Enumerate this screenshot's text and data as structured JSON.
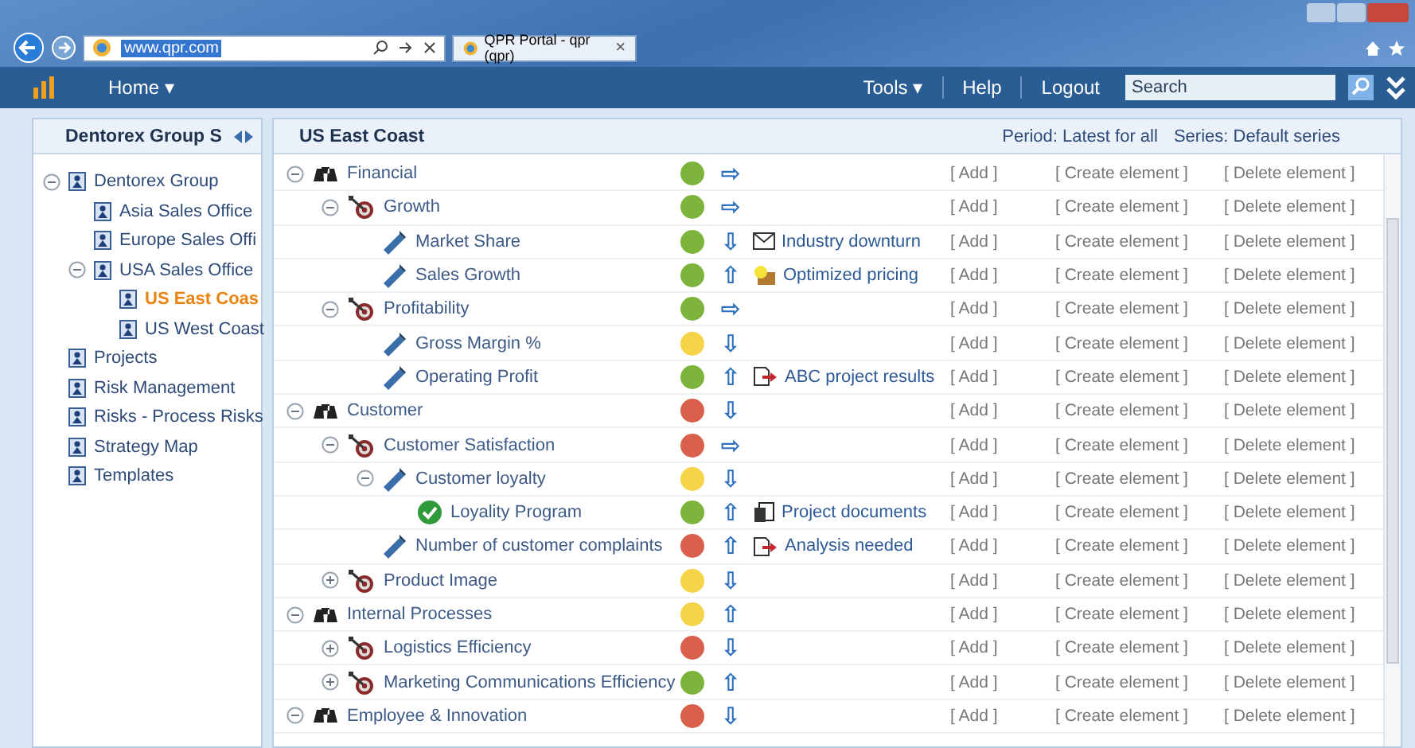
{
  "browser": {
    "address": "www.qpr.com",
    "tab": {
      "label": "QPR Portal - qpr (qpr)",
      "close": "×"
    }
  },
  "app_bar": {
    "home": "Home ▾",
    "menu": [
      {
        "label": "Tools ▾"
      },
      {
        "label": "Help"
      },
      {
        "label": "Logout"
      }
    ],
    "search": {
      "placeholder": "Search"
    }
  },
  "sidebar": {
    "title": "Dentorex Group S",
    "items": [
      {
        "label": "Dentorex Group",
        "expanded": true,
        "selected": false,
        "children": [
          {
            "label": "Asia Sales Office",
            "selected": false
          },
          {
            "label": "Europe Sales Offi",
            "selected": false
          },
          {
            "label": "USA Sales Office",
            "expanded": true,
            "selected": false,
            "children": [
              {
                "label": "US East Coas",
                "selected": true
              },
              {
                "label": "US West Coast",
                "selected": false
              }
            ]
          }
        ]
      },
      {
        "label": "Projects",
        "selected": false
      },
      {
        "label": "Risk Management",
        "selected": false
      },
      {
        "label": "Risks - Process Risks",
        "selected": false
      },
      {
        "label": "Strategy Map",
        "selected": false
      },
      {
        "label": "Templates",
        "selected": false
      }
    ]
  },
  "scorecard": {
    "title": "US East Coast",
    "period": "Period: Latest for all",
    "series": "Series: Default series",
    "rows": [
      {
        "name": "Financial",
        "kind": "perspective",
        "expanded": true,
        "color": "#7cb43c",
        "trend": "⇨",
        "links": [
          "[ Add ]",
          "[ Create element ]",
          "[ Delete element ]"
        ],
        "children": [
          {
            "name": "Growth",
            "kind": "goal",
            "expanded": true,
            "color": "#7cb43c",
            "trend": "⇨",
            "links": [
              "[ Add ]",
              "[ Create element ]",
              "[ Delete element ]"
            ],
            "children": [
              {
                "name": "Market Share",
                "kind": "measure",
                "color": "#7cb43c",
                "trend": "⇩",
                "note": {
                  "kind": "mail",
                  "text": "Industry downturn"
                },
                "links": [
                  "[ Add ]",
                  "[ Create element ]",
                  "[ Delete element ]"
                ]
              },
              {
                "name": "Sales Growth",
                "kind": "measure",
                "color": "#7cb43c",
                "trend": "⇧",
                "note": {
                  "kind": "idea",
                  "text": "Optimized pricing"
                },
                "links": [
                  "[ Add ]",
                  "[ Create element ]",
                  "[ Delete element ]"
                ]
              }
            ]
          },
          {
            "name": "Profitability",
            "kind": "goal",
            "expanded": true,
            "color": "#7cb43c",
            "trend": "⇨",
            "links": [
              "[ Add ]",
              "[ Create element ]",
              "[ Delete element ]"
            ],
            "children": [
              {
                "name": "Gross Margin %",
                "kind": "measure",
                "color": "#f5d447",
                "trend": "⇩",
                "links": [
                  "[ Add ]",
                  "[ Create element ]",
                  "[ Delete element ]"
                ]
              },
              {
                "name": "Operating Profit",
                "kind": "measure",
                "color": "#7cb43c",
                "trend": "⇧",
                "note": {
                  "kind": "action",
                  "text": "ABC project results"
                },
                "links": [
                  "[ Add ]",
                  "[ Create element ]",
                  "[ Delete element ]"
                ]
              }
            ]
          }
        ]
      },
      {
        "name": "Customer",
        "kind": "perspective",
        "expanded": true,
        "color": "#d9614c",
        "trend": "⇩",
        "links": [
          "[ Add ]",
          "[ Create element ]",
          "[ Delete element ]"
        ],
        "children": [
          {
            "name": "Customer Satisfaction",
            "kind": "goal",
            "expanded": true,
            "color": "#d9614c",
            "trend": "⇨",
            "links": [
              "[ Add ]",
              "[ Create element ]",
              "[ Delete element ]"
            ],
            "children": [
              {
                "name": "Customer loyalty",
                "kind": "measure",
                "expanded": true,
                "color": "#f5d447",
                "trend": "⇩",
                "links": [
                  "[ Add ]",
                  "[ Create element ]",
                  "[ Delete element ]"
                ],
                "children": [
                  {
                    "name": "Loyality Program",
                    "kind": "check",
                    "color": "#7cb43c",
                    "trend": "⇧",
                    "note": {
                      "kind": "document",
                      "text": "Project documents"
                    },
                    "links": [
                      "[ Add ]",
                      "[ Create element ]",
                      "[ Delete element ]"
                    ]
                  }
                ]
              },
              {
                "name": "Number of customer complaints",
                "kind": "measure",
                "color": "#d9614c",
                "trend": "⇧",
                "note": {
                  "kind": "action",
                  "text": "Analysis needed"
                },
                "links": [
                  "[ Add ]",
                  "[ Create element ]",
                  "[ Delete element ]"
                ]
              }
            ]
          },
          {
            "name": "Product Image",
            "kind": "goal",
            "expanded": false,
            "color": "#f5d447",
            "trend": "⇩",
            "links": [
              "[ Add ]",
              "[ Create element ]",
              "[ Delete element ]"
            ]
          }
        ]
      },
      {
        "name": "Internal Processes",
        "kind": "perspective",
        "expanded": true,
        "color": "#f5d447",
        "trend": "⇧",
        "links": [
          "[ Add ]",
          "[ Create element ]",
          "[ Delete element ]"
        ],
        "children": [
          {
            "name": "Logistics Efficiency",
            "kind": "goal",
            "expanded": false,
            "color": "#d9614c",
            "trend": "⇩",
            "links": [
              "[ Add ]",
              "[ Create element ]",
              "[ Delete element ]"
            ]
          },
          {
            "name": "Marketing Communications Efficiency",
            "kind": "goal",
            "expanded": false,
            "color": "#7cb43c",
            "trend": "⇧",
            "links": [
              "[ Add ]",
              "[ Create element ]",
              "[ Delete element ]"
            ]
          }
        ]
      },
      {
        "name": "Employee & Innovation",
        "kind": "perspective",
        "expanded": true,
        "color": "#d9614c",
        "trend": "⇩",
        "links": [
          "[ Add ]",
          "[ Create element ]",
          "[ Delete element ]"
        ]
      }
    ]
  }
}
